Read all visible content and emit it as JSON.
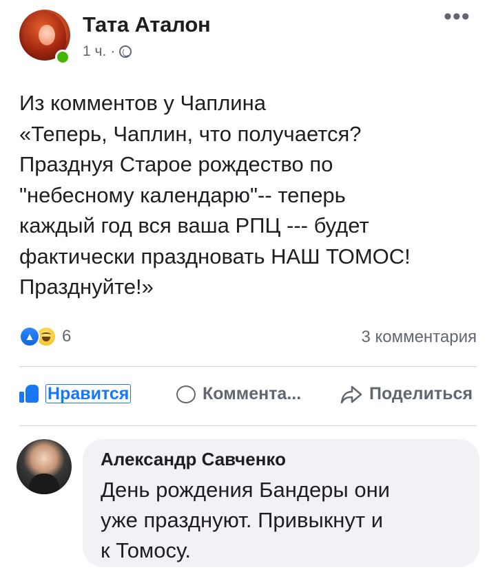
{
  "post": {
    "author": "Тата Аталон",
    "time": "1 ч.",
    "separator": "·",
    "body_lines": [
      "Из комментов у Чаплина",
      "«Теперь, Чаплин, что получается?",
      "Празднуя Старое рождество по",
      "\"небесному календарю\"-- теперь",
      "каждый год вся ваша РПЦ  --- будет",
      "фактически праздновать НАШ ТОМОС!",
      "Празднуйте!»"
    ],
    "reaction_count": "6",
    "comments_count": "3 комментария"
  },
  "actions": {
    "like": "Нравится",
    "comment": "Коммента...",
    "share": "Поделиться"
  },
  "comment": {
    "author": "Александр Савченко",
    "lines": [
      "День рождения Бандеры они",
      "уже празднуют. Привыкнут и",
      "к Томосу."
    ]
  },
  "icons": {
    "more": "more-icon",
    "globe": "globe-icon",
    "like_reaction": "like-reaction-icon",
    "haha_reaction": "haha-reaction-icon"
  },
  "colors": {
    "accent": "#1877f2",
    "online": "#44b700",
    "secondary_text": "#606770",
    "comment_bg": "#f0f2f5"
  }
}
